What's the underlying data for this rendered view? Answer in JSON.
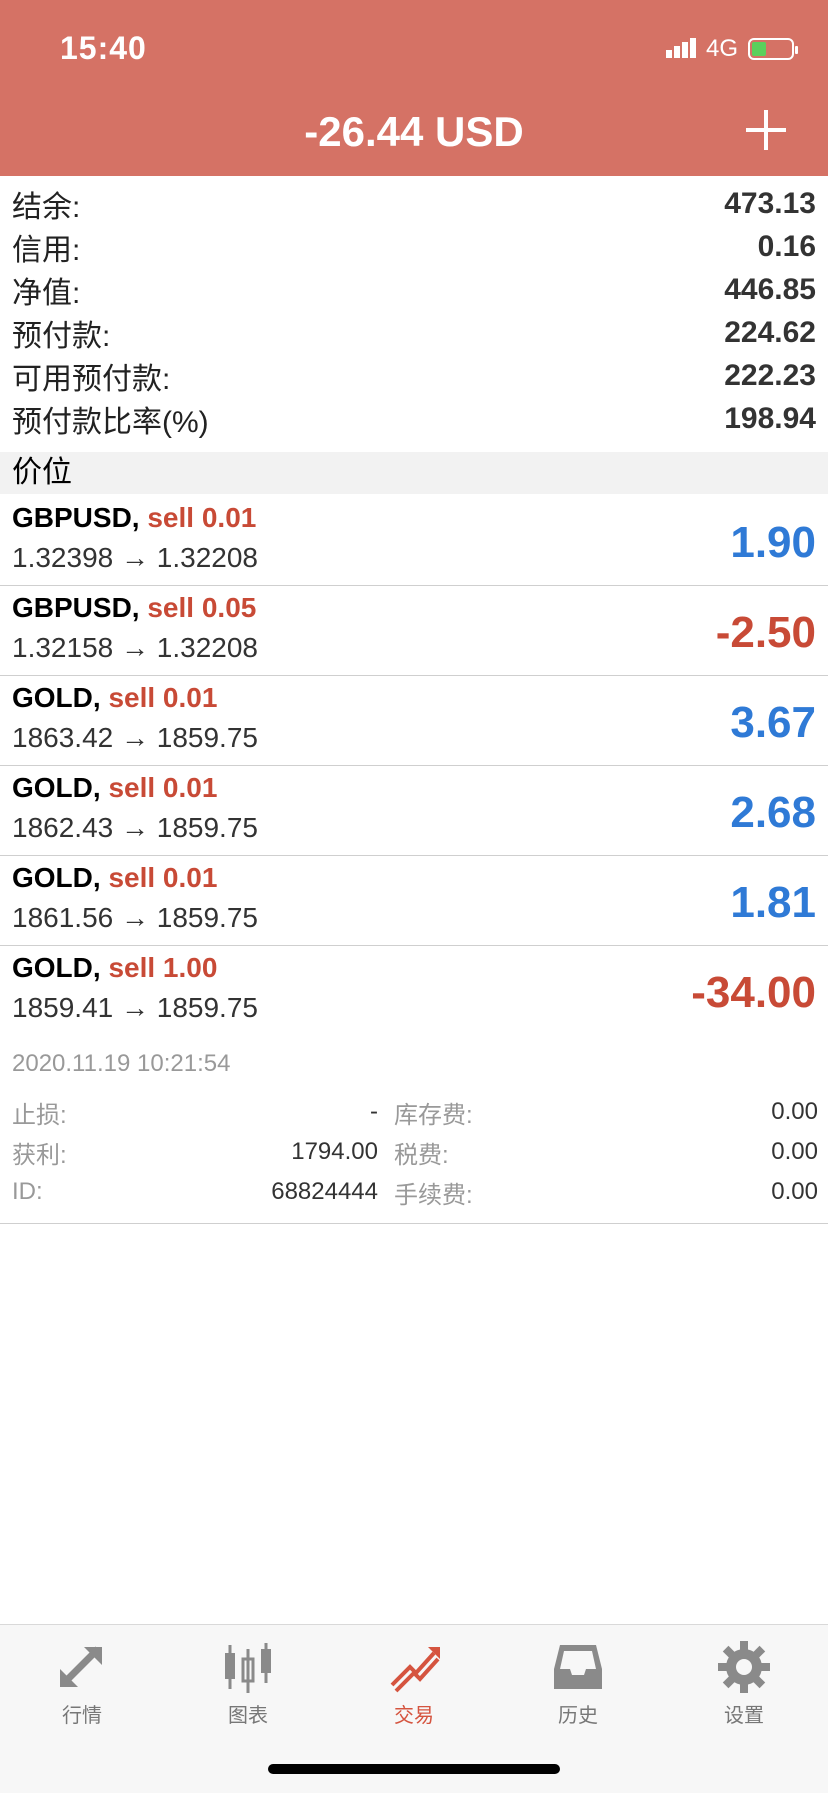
{
  "status_bar": {
    "time": "15:40",
    "network": "4G"
  },
  "header": {
    "title": "-26.44 USD",
    "add_icon": "plus-icon"
  },
  "summary": [
    {
      "label": "结余:",
      "value": "473.13"
    },
    {
      "label": "信用:",
      "value": "0.16"
    },
    {
      "label": "净值:",
      "value": "446.85"
    },
    {
      "label": "预付款:",
      "value": "224.62"
    },
    {
      "label": "可用预付款:",
      "value": "222.23"
    },
    {
      "label": "预付款比率(%)",
      "value": "198.94"
    }
  ],
  "section_title": "价位",
  "positions": [
    {
      "symbol": "GBPUSD,",
      "side": "sell 0.01",
      "prices": "1.32398 → 1.32208",
      "pl": "1.90",
      "pl_color": "#2f7ad6"
    },
    {
      "symbol": "GBPUSD,",
      "side": "sell 0.05",
      "prices": "1.32158 → 1.32208",
      "pl": "-2.50",
      "pl_color": "#c84a36"
    },
    {
      "symbol": "GOLD,",
      "side": "sell 0.01",
      "prices": "1863.42 → 1859.75",
      "pl": "3.67",
      "pl_color": "#2f7ad6"
    },
    {
      "symbol": "GOLD,",
      "side": "sell 0.01",
      "prices": "1862.43 → 1859.75",
      "pl": "2.68",
      "pl_color": "#2f7ad6"
    },
    {
      "symbol": "GOLD,",
      "side": "sell 0.01",
      "prices": "1861.56 → 1859.75",
      "pl": "1.81",
      "pl_color": "#2f7ad6"
    },
    {
      "symbol": "GOLD,",
      "side": "sell 1.00",
      "prices": "1859.41 → 1859.75",
      "pl": "-34.00",
      "pl_color": "#c84a36"
    }
  ],
  "detail": {
    "time": "2020.11.19 10:21:54",
    "rows": [
      {
        "label": "止损:",
        "value": "-",
        "label2": "库存费:",
        "value2": "0.00"
      },
      {
        "label": "获利:",
        "value": "1794.00",
        "label2": "税费:",
        "value2": "0.00"
      },
      {
        "label": "ID:",
        "value": "68824444",
        "label2": "手续费:",
        "value2": "0.00"
      }
    ]
  },
  "tabs": [
    {
      "label": "行情",
      "icon": "quotes-arrows-icon",
      "active": false
    },
    {
      "label": "图表",
      "icon": "candlestick-chart-icon",
      "active": false
    },
    {
      "label": "交易",
      "icon": "trade-trend-icon",
      "active": true
    },
    {
      "label": "历史",
      "icon": "history-inbox-icon",
      "active": false
    },
    {
      "label": "设置",
      "icon": "gear-icon",
      "active": false
    }
  ],
  "colors": {
    "header_bg": "#d57265",
    "profit": "#2f7ad6",
    "loss": "#c84a36",
    "active_tab": "#d5543f"
  }
}
